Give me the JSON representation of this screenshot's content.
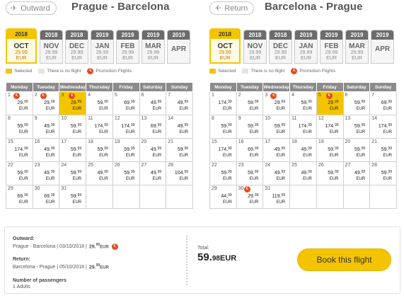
{
  "outward": {
    "dir_label": "Outward",
    "route": "Prague - Barcelona",
    "months": [
      {
        "year": "2018",
        "month": "OCT",
        "price": "29.99",
        "currency": "EUR",
        "active": true
      },
      {
        "year": "2018",
        "month": "NOV",
        "price": "29.99",
        "currency": "EUR"
      },
      {
        "year": "2018",
        "month": "DEC",
        "price": "29.99",
        "currency": "EUR"
      },
      {
        "year": "2019",
        "month": "JAN",
        "price": "29.99",
        "currency": "EUR"
      },
      {
        "year": "2019",
        "month": "FEB",
        "price": "29.99",
        "currency": "EUR"
      },
      {
        "year": "2019",
        "month": "MAR",
        "price": "29.99",
        "currency": "EUR"
      },
      {
        "year": "2019",
        "month": "APR",
        "price": "",
        "currency": ""
      }
    ],
    "days": [
      {
        "d": "1",
        "p": "29.99",
        "promo": true
      },
      {
        "d": "2",
        "p": "29.99",
        "promo": true
      },
      {
        "d": "3",
        "p": "29.99",
        "promo": true,
        "sel": true
      },
      {
        "d": "4",
        "p": "59.99"
      },
      {
        "d": "5",
        "p": "69.99"
      },
      {
        "d": "6",
        "p": "49.99"
      },
      {
        "d": "7",
        "p": "49.99"
      },
      {
        "d": "8",
        "p": "59.99"
      },
      {
        "d": "9",
        "p": "49.99"
      },
      {
        "d": "10",
        "p": "59.99"
      },
      {
        "d": "11",
        "p": "174.99"
      },
      {
        "d": "12",
        "p": "174.99"
      },
      {
        "d": "13",
        "p": "69.99"
      },
      {
        "d": "14",
        "p": "49.99"
      },
      {
        "d": "15",
        "p": "174.99"
      },
      {
        "d": "16",
        "p": "49.99"
      },
      {
        "d": "17",
        "p": "59.99"
      },
      {
        "d": "18",
        "p": "59.99"
      },
      {
        "d": "19",
        "p": "59.99"
      },
      {
        "d": "20",
        "p": "49.99"
      },
      {
        "d": "21",
        "p": "59.99"
      },
      {
        "d": "22",
        "p": "59.99"
      },
      {
        "d": "23",
        "p": "49.99"
      },
      {
        "d": "24",
        "p": "59.99"
      },
      {
        "d": "25",
        "p": "49.99"
      },
      {
        "d": "26",
        "p": "59.99"
      },
      {
        "d": "27",
        "p": "49.99"
      },
      {
        "d": "28",
        "p": "104.99"
      },
      {
        "d": "29",
        "p": "69.99"
      },
      {
        "d": "30",
        "p": "69.99"
      },
      {
        "d": "31",
        "p": "59.99"
      },
      {
        "d": ""
      },
      {
        "d": ""
      },
      {
        "d": ""
      },
      {
        "d": ""
      }
    ]
  },
  "return": {
    "dir_label": "Return",
    "route": "Barcelona - Prague",
    "months": [
      {
        "year": "2018",
        "month": "OCT",
        "price": "29.99",
        "currency": "EUR",
        "active": true
      },
      {
        "year": "2018",
        "month": "NOV",
        "price": "29.99",
        "currency": "EUR"
      },
      {
        "year": "2018",
        "month": "DEC",
        "price": "29.99",
        "currency": "EUR"
      },
      {
        "year": "2019",
        "month": "JAN",
        "price": "29.99",
        "currency": "EUR"
      },
      {
        "year": "2019",
        "month": "FEB",
        "price": "29.99",
        "currency": "EUR"
      },
      {
        "year": "2019",
        "month": "MAR",
        "price": "29.99",
        "currency": "EUR"
      },
      {
        "year": "2019",
        "month": "APR",
        "price": "",
        "currency": ""
      }
    ],
    "days": [
      {
        "d": "1",
        "p": "174.99"
      },
      {
        "d": "2",
        "p": "59.99"
      },
      {
        "d": "3",
        "p": "29.99",
        "promo": true
      },
      {
        "d": "4",
        "p": "59.99"
      },
      {
        "d": "5",
        "p": "29.99",
        "promo": true,
        "sel": true
      },
      {
        "d": "6",
        "p": "59.99"
      },
      {
        "d": "7",
        "p": "69.99"
      },
      {
        "d": "8",
        "p": "59.99"
      },
      {
        "d": "9",
        "p": "59.99"
      },
      {
        "d": "10",
        "p": "59.99"
      },
      {
        "d": "11",
        "p": "174.99"
      },
      {
        "d": "12",
        "p": "174.99"
      },
      {
        "d": "13",
        "p": "59.99"
      },
      {
        "d": "14",
        "p": "174.99"
      },
      {
        "d": "15",
        "p": "174.99"
      },
      {
        "d": "16",
        "p": "69.99"
      },
      {
        "d": "17",
        "p": "49.99"
      },
      {
        "d": "18",
        "p": "49.99"
      },
      {
        "d": "19",
        "p": "59.99"
      },
      {
        "d": "20",
        "p": "59.99"
      },
      {
        "d": "21",
        "p": "59.99"
      },
      {
        "d": "22",
        "p": "59.99"
      },
      {
        "d": "23",
        "p": "59.99"
      },
      {
        "d": "24",
        "p": "49.99"
      },
      {
        "d": "25",
        "p": "49.99"
      },
      {
        "d": "26",
        "p": "59.99"
      },
      {
        "d": "27",
        "p": "49.99"
      },
      {
        "d": "28",
        "p": "59.99"
      },
      {
        "d": "29",
        "p": "44.99"
      },
      {
        "d": "30",
        "p": "29.99",
        "promo": true
      },
      {
        "d": "31",
        "p": "119.99"
      },
      {
        "d": ""
      },
      {
        "d": ""
      },
      {
        "d": ""
      },
      {
        "d": ""
      }
    ]
  },
  "weekdays": [
    "Monday",
    "Tuesday",
    "Wednesday",
    "Thursday",
    "Friday",
    "Saturday",
    "Sunday"
  ],
  "legend": {
    "selected": "Selected",
    "no_flight": "There is no flight",
    "promo": "Promotion Flights"
  },
  "summary": {
    "outward_label": "Outward:",
    "outward_text": "Prague - Barcelona | 03/10/2018 |",
    "outward_price": "29",
    "outward_cents": "99",
    "outward_cur": "EUR",
    "return_label": "Return:",
    "return_text": "Barcelona - Prague | 05/10/2018 |",
    "return_price": "29",
    "return_cents": "99",
    "return_cur": "EUR",
    "passengers_label": "Number of passengers",
    "passengers_value": "1 Adults",
    "total_label": "Total:",
    "total_int": "59.",
    "total_cents": "98",
    "total_cur": "EUR",
    "book_label": "Book this flight"
  },
  "colors": {
    "accent": "#f4c400",
    "promo": "#e14b1e",
    "header_gray": "#8b8b8b"
  },
  "icons": {
    "plane": "airplane-icon",
    "promo": "promotion-icon"
  }
}
